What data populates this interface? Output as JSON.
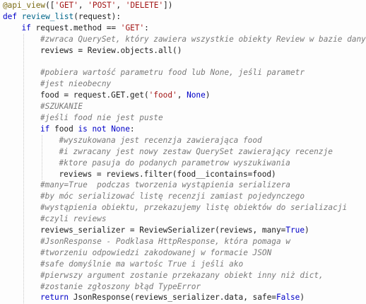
{
  "code": {
    "lines": [
      {
        "indent": 0,
        "tokens": [
          {
            "t": "@api_view",
            "c": "dec"
          },
          {
            "t": "([",
            "c": "plain"
          },
          {
            "t": "'GET'",
            "c": "str"
          },
          {
            "t": ", ",
            "c": "plain"
          },
          {
            "t": "'POST'",
            "c": "str"
          },
          {
            "t": ", ",
            "c": "plain"
          },
          {
            "t": "'DELETE'",
            "c": "str"
          },
          {
            "t": "])",
            "c": "plain"
          }
        ]
      },
      {
        "indent": 0,
        "tokens": [
          {
            "t": "def",
            "c": "kw"
          },
          {
            "t": " ",
            "c": "plain"
          },
          {
            "t": "review_list",
            "c": "fn"
          },
          {
            "t": "(request):",
            "c": "plain"
          }
        ]
      },
      {
        "indent": 1,
        "tokens": [
          {
            "t": "if",
            "c": "kw"
          },
          {
            "t": " request.method == ",
            "c": "plain"
          },
          {
            "t": "'GET'",
            "c": "str"
          },
          {
            "t": ":",
            "c": "plain"
          }
        ]
      },
      {
        "indent": 2,
        "tokens": [
          {
            "t": "#zwraca QuerySet, który zawiera wszystkie obiekty Review w bazie danych",
            "c": "cm"
          }
        ]
      },
      {
        "indent": 2,
        "tokens": [
          {
            "t": "reviews = Review.objects.all()",
            "c": "plain"
          }
        ]
      },
      {
        "indent": 0,
        "tokens": []
      },
      {
        "indent": 2,
        "tokens": [
          {
            "t": "#pobiera wartość parametru food lub None, jeśli parametr",
            "c": "cm"
          }
        ]
      },
      {
        "indent": 2,
        "tokens": [
          {
            "t": "#jest nieobecny",
            "c": "cm"
          }
        ]
      },
      {
        "indent": 2,
        "tokens": [
          {
            "t": "food = request.GET.get(",
            "c": "plain"
          },
          {
            "t": "'food'",
            "c": "str"
          },
          {
            "t": ", ",
            "c": "plain"
          },
          {
            "t": "None",
            "c": "kw"
          },
          {
            "t": ")",
            "c": "plain"
          }
        ]
      },
      {
        "indent": 2,
        "tokens": [
          {
            "t": "#SZUKANIE",
            "c": "cm"
          }
        ]
      },
      {
        "indent": 2,
        "tokens": [
          {
            "t": "#jeśli food nie jest puste",
            "c": "cm"
          }
        ]
      },
      {
        "indent": 2,
        "tokens": [
          {
            "t": "if",
            "c": "kw"
          },
          {
            "t": " food ",
            "c": "plain"
          },
          {
            "t": "is not",
            "c": "kw"
          },
          {
            "t": " ",
            "c": "plain"
          },
          {
            "t": "None",
            "c": "kw"
          },
          {
            "t": ":",
            "c": "plain"
          }
        ]
      },
      {
        "indent": 3,
        "tokens": [
          {
            "t": "#wyszukowana jest recenzja zawierająca food",
            "c": "cm"
          }
        ]
      },
      {
        "indent": 3,
        "tokens": [
          {
            "t": "#i zwracany jest nowy zestaw QuerySet zawierający recenzje",
            "c": "cm"
          }
        ]
      },
      {
        "indent": 3,
        "tokens": [
          {
            "t": "#ktore pasuja do podanych parametrow wyszukiwania",
            "c": "cm"
          }
        ]
      },
      {
        "indent": 3,
        "tokens": [
          {
            "t": "reviews = reviews.filter(food__icontains=food)",
            "c": "plain"
          }
        ]
      },
      {
        "indent": 2,
        "tokens": [
          {
            "t": "#many=True  podczas tworzenia wystąpienia serializera",
            "c": "cm"
          }
        ]
      },
      {
        "indent": 2,
        "tokens": [
          {
            "t": "#by móc serializować listę recenzji zamiast pojedynczego",
            "c": "cm"
          }
        ]
      },
      {
        "indent": 2,
        "tokens": [
          {
            "t": "#wystąpienia obiektu, przekazujemy listę obiektów do serializacji",
            "c": "cm"
          }
        ]
      },
      {
        "indent": 2,
        "tokens": [
          {
            "t": "#czyli reviews",
            "c": "cm"
          }
        ]
      },
      {
        "indent": 2,
        "tokens": [
          {
            "t": "reviews_serializer = ReviewSerializer(reviews, many=",
            "c": "plain"
          },
          {
            "t": "True",
            "c": "kw"
          },
          {
            "t": ")",
            "c": "plain"
          }
        ]
      },
      {
        "indent": 2,
        "tokens": [
          {
            "t": "#JsonResponse - Podklasa HttpResponse, która pomaga w",
            "c": "cm"
          }
        ]
      },
      {
        "indent": 2,
        "tokens": [
          {
            "t": "#tworzeniu odpowiedzi zakodowanej w formacie JSON",
            "c": "cm"
          }
        ]
      },
      {
        "indent": 2,
        "tokens": [
          {
            "t": "#safe domyślnie ma wartośc True i jeśli ako",
            "c": "cm"
          }
        ]
      },
      {
        "indent": 2,
        "tokens": [
          {
            "t": "#pierwszy argument zostanie przekazany obiekt inny niż dict,",
            "c": "cm"
          }
        ]
      },
      {
        "indent": 2,
        "tokens": [
          {
            "t": "#zostanie zgłoszony błąd TypeError",
            "c": "cm"
          }
        ]
      },
      {
        "indent": 2,
        "tokens": [
          {
            "t": "return",
            "c": "kw"
          },
          {
            "t": " JsonResponse(reviews_serializer.data, safe=",
            "c": "plain"
          },
          {
            "t": "False",
            "c": "kw"
          },
          {
            "t": ")",
            "c": "plain"
          }
        ]
      }
    ]
  }
}
